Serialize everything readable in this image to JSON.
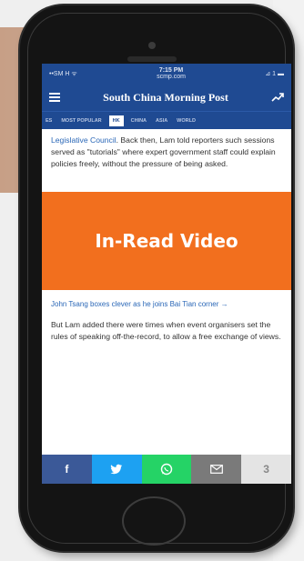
{
  "status_bar": {
    "carrier": "••SM H ᯤ",
    "time": "7:15 PM",
    "subtitle": "scmp.com",
    "battery": "⊿ 1 ▬"
  },
  "header": {
    "masthead": "South China Morning Post"
  },
  "nav_tabs": [
    "ES",
    "MOST POPULAR",
    "HK",
    "CHINA",
    "ASIA",
    "WORLD"
  ],
  "article": {
    "link_text": "Legislative Council",
    "paragraph_1": ". Back then, Lam told reporters such sessions served as \"tutorials\" where expert government staff could explain policies freely, without the pressure of being asked.",
    "video_label": "In-Read Video",
    "related_link": "John Tsang boxes clever as he joins Bai Tian corner →",
    "paragraph_2": "But Lam added there were times when event organisers set the rules of speaking off-the-record, to allow a free exchange of views."
  },
  "share_bar": {
    "facebook": "f",
    "twitter": "twitter-icon",
    "whatsapp": "whatsapp-icon",
    "email": "email-icon",
    "more": "3"
  },
  "colors": {
    "brand_blue": "#1f4a92",
    "video_orange": "#f26f1e",
    "link_blue": "#2a67b7"
  }
}
